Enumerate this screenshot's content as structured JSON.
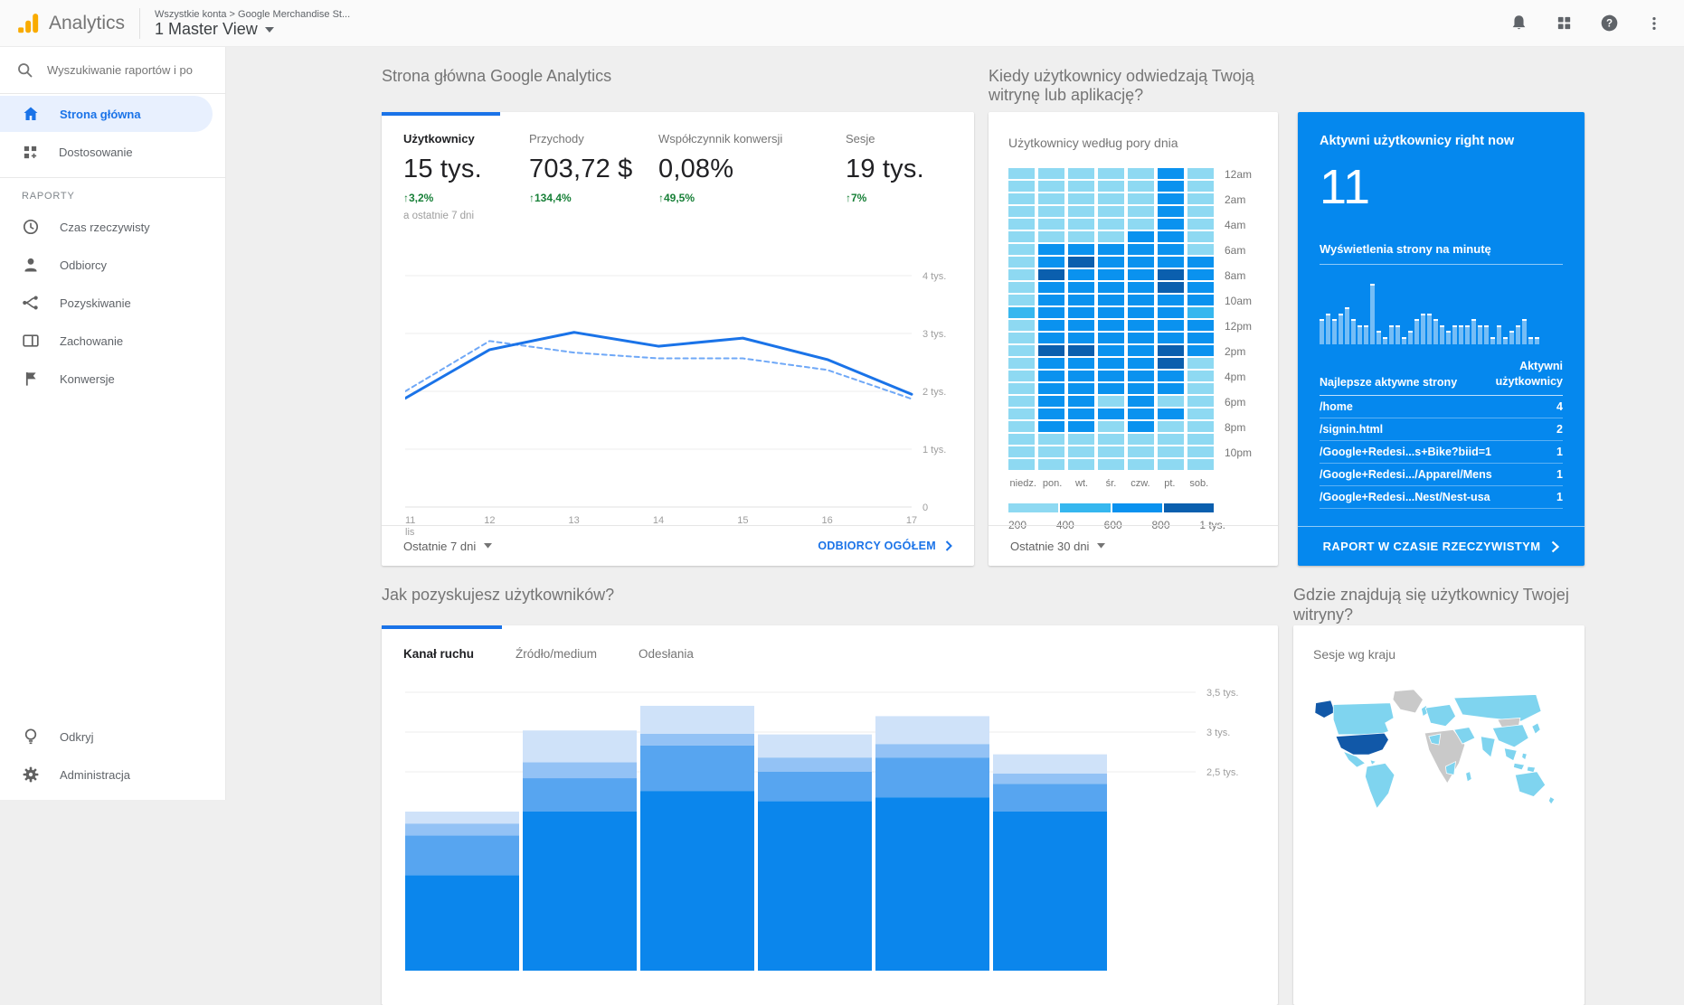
{
  "topbar": {
    "brand": "Analytics",
    "breadcrumb": "Wszystkie konta > Google Merchandise St...",
    "view_name": "1 Master View"
  },
  "sidebar": {
    "search_placeholder": "Wyszukiwanie raportów i po",
    "home": "Strona główna",
    "customization": "Dostosowanie",
    "section": "RAPORTY",
    "realtime": "Czas rzeczywisty",
    "audience": "Odbiorcy",
    "acquisition": "Pozyskiwanie",
    "behavior": "Zachowanie",
    "conversions": "Konwersje",
    "discover": "Odkryj",
    "admin": "Administracja"
  },
  "overview": {
    "section_title": "Strona główna Google Analytics",
    "metrics": [
      {
        "label": "Użytkownicy",
        "value": "15 tys.",
        "delta": "3,2%",
        "note": "a ostatnie 7 dni"
      },
      {
        "label": "Przychody",
        "value": "703,72 $",
        "delta": "134,4%"
      },
      {
        "label": "Współczynnik konwersji",
        "value": "0,08%",
        "delta": "49,5%"
      },
      {
        "label": "Sesje",
        "value": "19 tys.",
        "delta": "7%"
      }
    ],
    "footer_range": "Ostatnie 7 dni",
    "footer_link": "ODBIORCY OGÓŁEM"
  },
  "when": {
    "section_title": "Kiedy użytkownicy odwiedzają Twoją witrynę lub aplikację?",
    "footer_range": "Ostatnie 30 dni"
  },
  "realtime": {
    "title": "Aktywni użytkownicy right now",
    "count": "11",
    "table_header_left": "Najlepsze aktywne strony",
    "table_header_right": "Aktywni użytkownicy",
    "rows": [
      {
        "page": "/home",
        "users": "4"
      },
      {
        "page": "/signin.html",
        "users": "2"
      },
      {
        "page": "/Google+Redesi...s+Bike?biid=1",
        "users": "1"
      },
      {
        "page": "/Google+Redesi.../Apparel/Mens",
        "users": "1"
      },
      {
        "page": "/Google+Redesi...Nest/Nest-usa",
        "users": "1"
      }
    ],
    "footer_link": "RAPORT W CZASIE RZECZYWISTYM"
  },
  "acquisition": {
    "section_title": "Jak pozyskujesz użytkowników?",
    "tabs": [
      "Kanał ruchu",
      "Źródło/medium",
      "Odesłania"
    ]
  },
  "geo": {
    "section_title": "Gdzie znajdują się użytkownicy Twojej witryny?"
  },
  "icons": {
    "up_arrow": "↑",
    "help_glyph": "?"
  },
  "chart_data": [
    {
      "id": "users-trend",
      "type": "line",
      "title": "Użytkownicy",
      "x": [
        "11 lis",
        "12",
        "13",
        "14",
        "15",
        "16",
        "17"
      ],
      "series": [
        {
          "name": "bieżący okres",
          "style": "solid",
          "color": "#1a73e8",
          "values": [
            1880,
            2720,
            3020,
            2780,
            2920,
            2550,
            1950
          ]
        },
        {
          "name": "poprzedni okres",
          "style": "dashed",
          "color": "#6fa8f7",
          "values": [
            2000,
            2870,
            2670,
            2570,
            2570,
            2370,
            1870
          ]
        }
      ],
      "ylim": [
        0,
        4000
      ],
      "yticks": [
        {
          "value": 0,
          "label": "0"
        },
        {
          "value": 1000,
          "label": "1 tys."
        },
        {
          "value": 2000,
          "label": "2 tys."
        },
        {
          "value": 3000,
          "label": "3 tys."
        },
        {
          "value": 4000,
          "label": "4 tys."
        }
      ],
      "grid": true,
      "legend_position": "none"
    },
    {
      "id": "users-by-time-of-day",
      "type": "heatmap",
      "title": "Użytkownicy według pory dnia",
      "columns": [
        "niedz.",
        "pon.",
        "wt.",
        "śr.",
        "czw.",
        "pt.",
        "sob."
      ],
      "row_labels": [
        "12am",
        "2am",
        "4am",
        "6am",
        "8am",
        "10am",
        "12pm",
        "2pm",
        "4pm",
        "6pm",
        "8pm",
        "10pm"
      ],
      "palette": [
        "#8ed9f2",
        "#36b7ef",
        "#0a92ef",
        "#0b5fae"
      ],
      "legend_ticks": [
        "200",
        "400",
        "600",
        "800",
        "1 tys."
      ],
      "matrix": [
        [
          0,
          0,
          0,
          0,
          0,
          2,
          0
        ],
        [
          0,
          0,
          0,
          0,
          0,
          2,
          0
        ],
        [
          0,
          0,
          0,
          0,
          0,
          2,
          0
        ],
        [
          0,
          0,
          0,
          0,
          0,
          2,
          0
        ],
        [
          0,
          0,
          0,
          0,
          0,
          2,
          0
        ],
        [
          0,
          0,
          0,
          0,
          2,
          2,
          0
        ],
        [
          0,
          2,
          2,
          2,
          2,
          2,
          0
        ],
        [
          0,
          2,
          3,
          2,
          2,
          2,
          2
        ],
        [
          0,
          3,
          2,
          2,
          2,
          3,
          2
        ],
        [
          0,
          2,
          2,
          2,
          2,
          3,
          2
        ],
        [
          0,
          2,
          2,
          2,
          2,
          2,
          2
        ],
        [
          1,
          2,
          2,
          2,
          2,
          2,
          1
        ],
        [
          0,
          2,
          2,
          2,
          2,
          2,
          2
        ],
        [
          0,
          2,
          2,
          2,
          2,
          2,
          2
        ],
        [
          0,
          3,
          3,
          2,
          2,
          3,
          2
        ],
        [
          0,
          2,
          2,
          2,
          2,
          3,
          0
        ],
        [
          0,
          2,
          2,
          2,
          2,
          2,
          0
        ],
        [
          0,
          2,
          2,
          2,
          2,
          2,
          0
        ],
        [
          0,
          2,
          2,
          0,
          2,
          0,
          0
        ],
        [
          0,
          2,
          2,
          2,
          2,
          2,
          0
        ],
        [
          0,
          2,
          2,
          0,
          2,
          0,
          0
        ],
        [
          0,
          0,
          0,
          0,
          0,
          0,
          0
        ],
        [
          0,
          0,
          0,
          0,
          0,
          0,
          0
        ],
        [
          0,
          0,
          0,
          0,
          0,
          0,
          0
        ]
      ]
    },
    {
      "id": "pageviews-per-minute",
      "type": "bar",
      "title": "Wyświetlenia strony na minutę",
      "values": [
        4,
        5,
        4,
        5,
        6,
        4,
        3,
        3,
        10,
        2,
        1,
        3,
        3,
        1,
        2,
        4,
        5,
        5,
        4,
        3,
        2,
        3,
        3,
        3,
        4,
        3,
        3,
        1,
        3,
        1,
        2,
        3,
        4,
        1,
        1
      ]
    },
    {
      "id": "acquisition-channels",
      "type": "bar",
      "stacked": true,
      "title": "Jak pozyskujesz użytkowników?",
      "active_tab": "Kanał ruchu",
      "yticks": [
        {
          "value": 2500,
          "label": "2,5 tys."
        },
        {
          "value": 3000,
          "label": "3 tys."
        },
        {
          "value": 3500,
          "label": "3,5 tys."
        }
      ],
      "segment_colors": [
        "#0b86ec",
        "#57a5f0",
        "#93c2f5",
        "#cfe2f9"
      ],
      "bars": [
        {
          "segments": [
            1200,
            500,
            150,
            150
          ]
        },
        {
          "segments": [
            2000,
            420,
            200,
            400
          ]
        },
        {
          "segments": [
            2260,
            570,
            150,
            350
          ]
        },
        {
          "segments": [
            2130,
            370,
            180,
            290
          ]
        },
        {
          "segments": [
            2180,
            500,
            170,
            350
          ]
        },
        {
          "segments": [
            2000,
            350,
            130,
            240
          ]
        }
      ]
    },
    {
      "id": "sessions-by-country",
      "type": "map",
      "title": "Sesje wg kraju",
      "colors": {
        "country": "#7fd4ef",
        "no_data": "#c9c9c9",
        "top_country": "#1158a8"
      },
      "top_country": "United States"
    }
  ]
}
